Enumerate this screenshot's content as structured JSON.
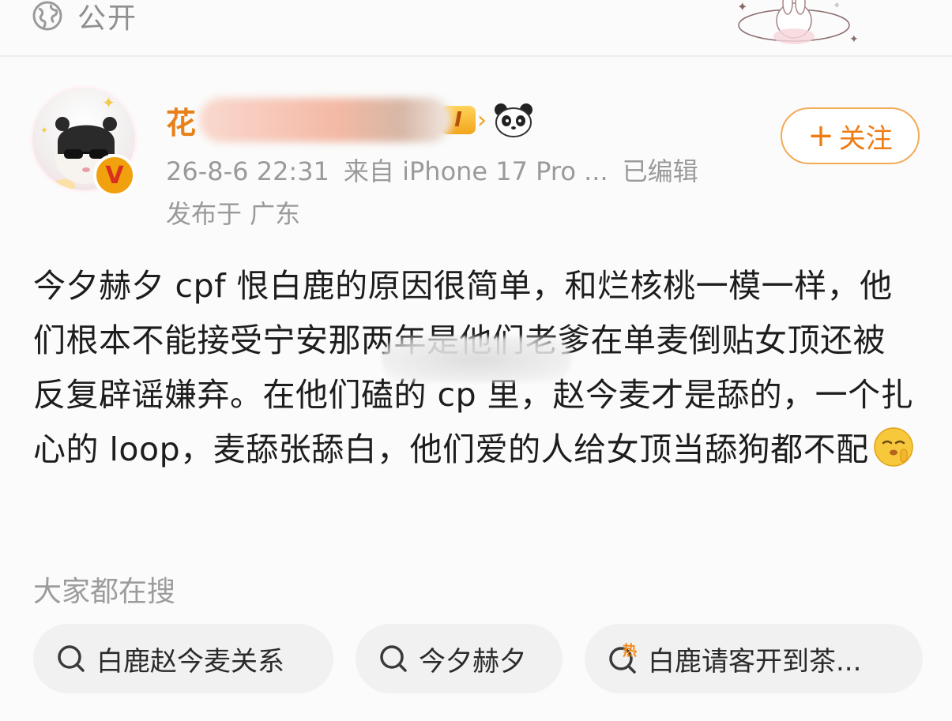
{
  "visibility": {
    "label": "公开",
    "icon": "globe-icon"
  },
  "author": {
    "name_visible": "花",
    "level_badge": "I",
    "verified_badge": "V",
    "meta": {
      "time": "26-8-6 22:31",
      "source": "来自 iPhone 17 Pro ...",
      "edited": "已编辑"
    },
    "location": "发布于 广东"
  },
  "follow_button": {
    "plus": "+",
    "label": "关注"
  },
  "post": {
    "text": "今夕赫夕 cpf 恨白鹿的原因很简单，和烂核桃一模一样，他们根本不能接受宁安那两年是他们老爹在单麦倒贴女顶还被反复辟谣嫌弃。在他们磕的 cp 里，赵今麦才是舔的，一个扎心的 loop，麦舔张舔白，他们爱的人给女顶当舔狗都不配",
    "emoji": "shushing-face"
  },
  "search": {
    "title": "大家都在搜",
    "chips": [
      {
        "label": "白鹿赵今麦关系",
        "icon": "search-icon"
      },
      {
        "label": "今夕赫夕",
        "icon": "search-icon"
      },
      {
        "label": "白鹿请客开到茶...",
        "icon": "hot-search-icon",
        "icon_text": "热"
      }
    ]
  },
  "colors": {
    "accent_orange": "#ee7c12",
    "username_orange": "#e8811a",
    "muted_gray": "#9a9a9a",
    "chip_bg": "#f1f1f1"
  }
}
